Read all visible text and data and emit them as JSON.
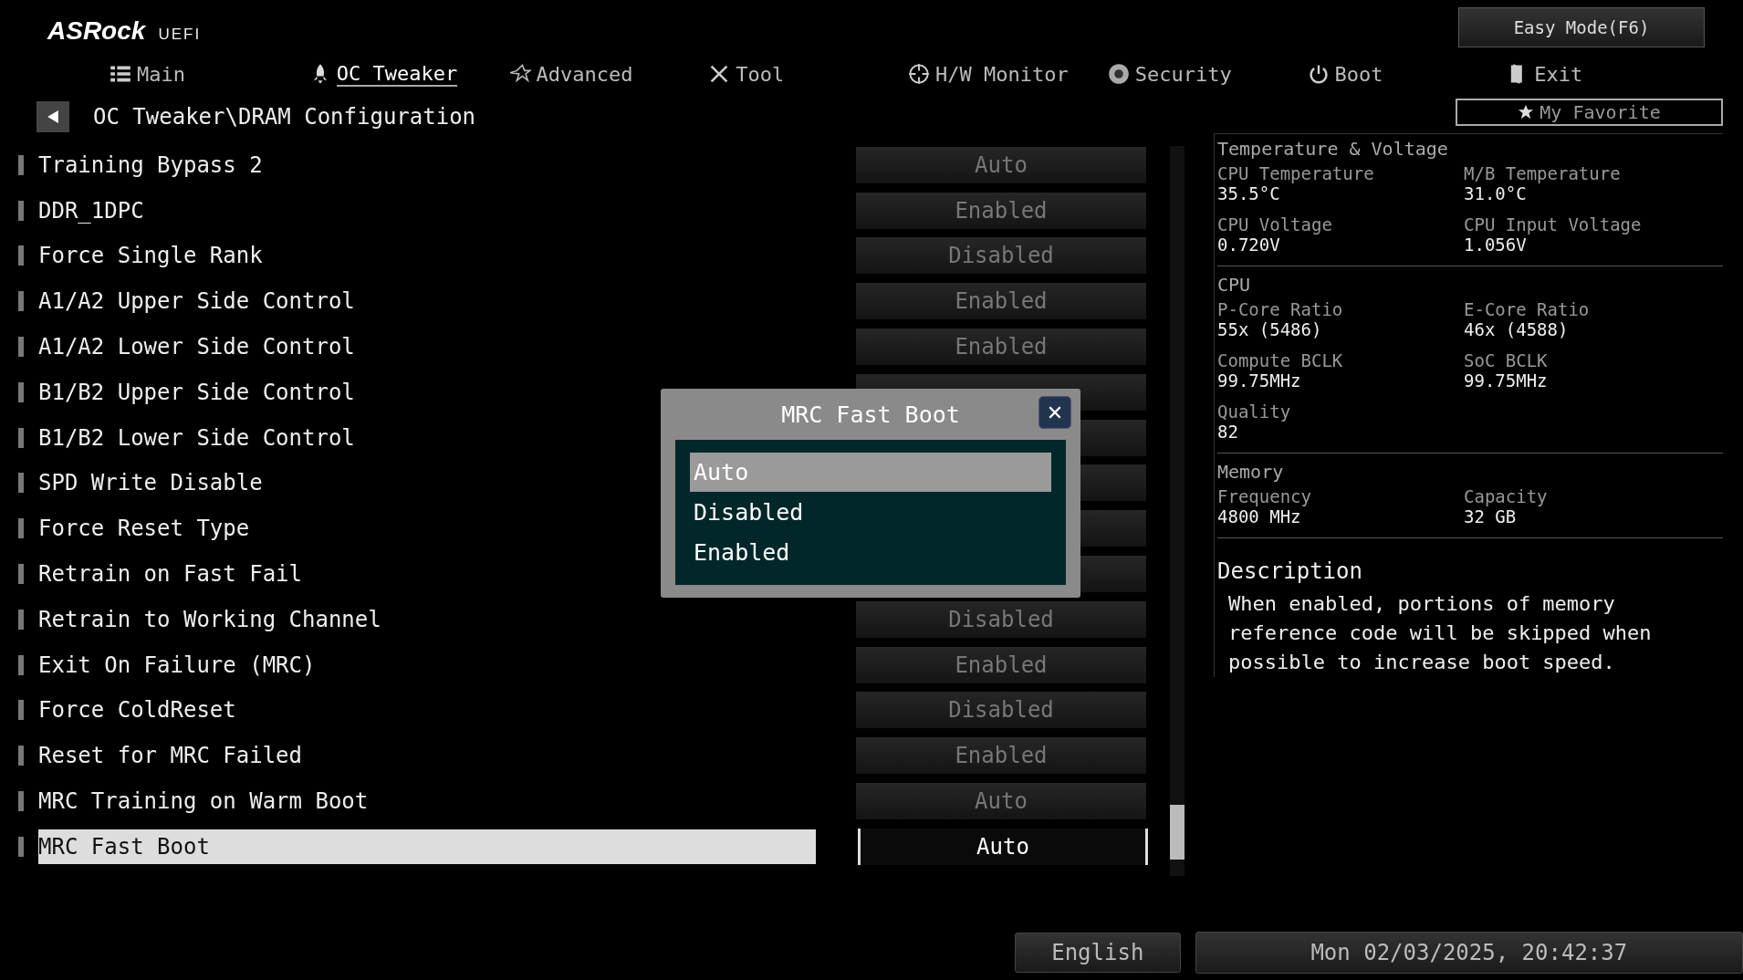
{
  "logo": {
    "brand": "ASRock",
    "sub": "UEFI"
  },
  "easy_mode_button": "Easy Mode(F6)",
  "tabs": [
    {
      "label": "Main",
      "selected": false
    },
    {
      "label": "OC Tweaker",
      "selected": true
    },
    {
      "label": "Advanced",
      "selected": false
    },
    {
      "label": "Tool",
      "selected": false
    },
    {
      "label": "H/W Monitor",
      "selected": false
    },
    {
      "label": "Security",
      "selected": false
    },
    {
      "label": "Boot",
      "selected": false
    },
    {
      "label": "Exit",
      "selected": false
    }
  ],
  "breadcrumb": "OC Tweaker\\DRAM Configuration",
  "favorite_button": "My Favorite",
  "settings": [
    {
      "label": "Training Bypass 2",
      "value": "Auto",
      "selected": false
    },
    {
      "label": "DDR_1DPC",
      "value": "Enabled",
      "selected": false
    },
    {
      "label": "Force Single Rank",
      "value": "Disabled",
      "selected": false
    },
    {
      "label": "A1/A2 Upper Side Control",
      "value": "Enabled",
      "selected": false
    },
    {
      "label": "A1/A2 Lower Side Control",
      "value": "Enabled",
      "selected": false
    },
    {
      "label": "B1/B2 Upper Side Control",
      "selected": false
    },
    {
      "label": "B1/B2 Lower Side Control",
      "selected": false
    },
    {
      "label": "SPD Write Disable",
      "selected": false
    },
    {
      "label": "Force Reset Type",
      "selected": false
    },
    {
      "label": "Retrain on Fast Fail",
      "selected": false
    },
    {
      "label": "Retrain to Working Channel",
      "value": "Disabled",
      "selected": false
    },
    {
      "label": "Exit On Failure (MRC)",
      "value": "Enabled",
      "selected": false
    },
    {
      "label": "Force ColdReset",
      "value": "Disabled",
      "selected": false
    },
    {
      "label": "Reset for MRC Failed",
      "value": "Enabled",
      "selected": false
    },
    {
      "label": "MRC Training on Warm Boot",
      "value": "Auto",
      "selected": false
    },
    {
      "label": "MRC Fast Boot",
      "value": "Auto",
      "selected": true
    }
  ],
  "popup": {
    "title": "MRC Fast Boot",
    "close": "✕",
    "options": [
      {
        "label": "Auto",
        "selected": true
      },
      {
        "label": "Disabled",
        "selected": false
      },
      {
        "label": "Enabled",
        "selected": false
      }
    ]
  },
  "info_sections": [
    {
      "title": "Temperature & Voltage",
      "items": [
        {
          "label": "CPU Temperature",
          "value": "35.5°C"
        },
        {
          "label": "M/B Temperature",
          "value": "31.0°C"
        },
        {
          "label": "CPU Voltage",
          "value": "0.720V"
        },
        {
          "label": "CPU Input Voltage",
          "value": "1.056V"
        }
      ]
    },
    {
      "title": "CPU",
      "items": [
        {
          "label": "P-Core Ratio",
          "value": "55x (5486)"
        },
        {
          "label": "E-Core Ratio",
          "value": "46x (4588)"
        },
        {
          "label": "Compute BCLK",
          "value": "99.75MHz"
        },
        {
          "label": "SoC BCLK",
          "value": "99.75MHz"
        },
        {
          "label": "Quality",
          "value": "82"
        }
      ]
    },
    {
      "title": "Memory",
      "items": [
        {
          "label": "Frequency",
          "value": "4800 MHz"
        },
        {
          "label": "Capacity",
          "value": "32 GB"
        }
      ]
    }
  ],
  "description": {
    "title": "Description",
    "text": "When enabled, portions of memory reference code will be skipped when possible to increase boot speed."
  },
  "footer": {
    "language": "English",
    "datetime": "Mon 02/03/2025, 20:42:37"
  }
}
